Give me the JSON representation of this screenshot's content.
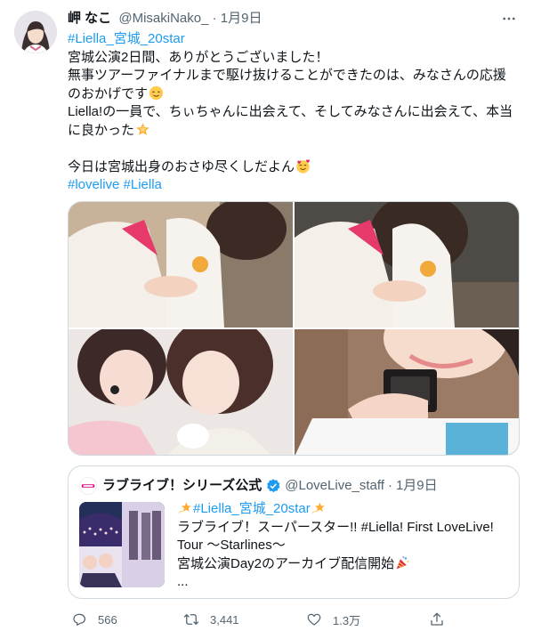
{
  "tweet": {
    "author_name": "岬 なこ",
    "author_handle": "@MisakiNako_",
    "separator": "·",
    "timestamp": "1月9日",
    "hashtag_top": "#Liella_宮城_20star",
    "lines": [
      "宮城公演2日間、ありがとうございました！",
      "無事ツアーファイナルまで駆け抜けることができたのは、みなさんの応援",
      "のおかげです",
      "Liella!の一員で、ちぃちゃんに出会えて、そしてみなさんに出会えて、本当",
      "に良かった",
      "今日は宮城出身のおさゆ尽くしだよん"
    ],
    "hashtags_bottom": "#lovelive #Liella",
    "icons": {
      "more": "more-dots-icon",
      "emoji_1": "relieved-face-emoji",
      "emoji_2": "glowing-star-emoji",
      "emoji_3": "smiling-face-with-hearts-emoji"
    }
  },
  "media": {
    "photo_count": 4
  },
  "quote": {
    "author_name": "ラブライブ！シリーズ公式",
    "author_handle": "@LoveLive_staff",
    "separator": "·",
    "timestamp": "1月9日",
    "lines": [
      "#Liella_宮城_20star",
      "ラブライブ！スーパースター!! #Liella! First LoveLive!",
      "Tour ～Starlines～",
      "宮城公演Day2のアーカイブ配信開始",
      "..."
    ],
    "icons": {
      "verified": "verified-badge-icon",
      "sparkle": "dizzy-star-emoji",
      "party": "party-popper-emoji"
    }
  },
  "actions": {
    "reply_count": "566",
    "retweet_count": "3,441",
    "like_count": "1.3万",
    "icons": [
      "reply-icon",
      "retweet-icon",
      "like-icon",
      "share-icon"
    ]
  },
  "colors": {
    "link": "#1d9bf0",
    "text": "#0f1419",
    "secondary": "#536471",
    "border": "#cfd9de"
  }
}
